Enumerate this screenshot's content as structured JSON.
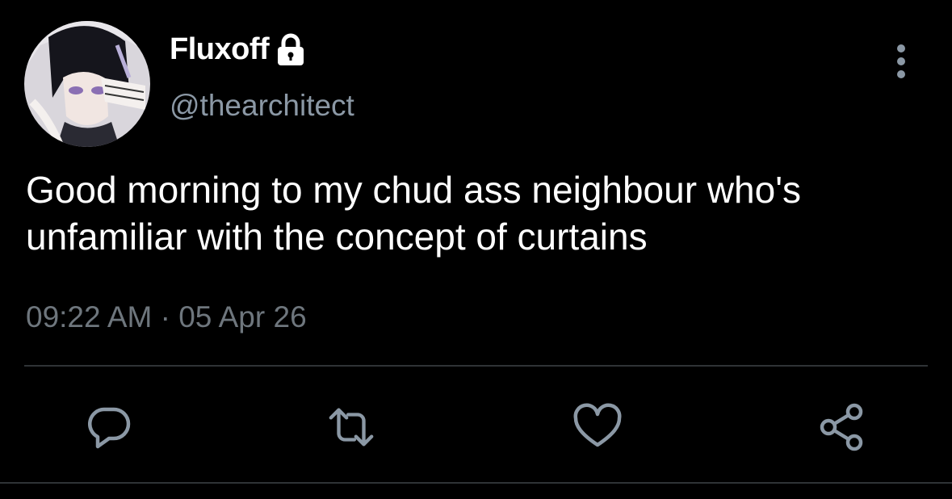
{
  "author": {
    "display_name": "Fluxoff",
    "handle": "@thearchitect",
    "protected": true
  },
  "tweet": {
    "text": "Good morning to my chud ass neighbour who's unfamiliar with the concept of curtains",
    "time": "09:22 AM",
    "separator": "·",
    "date": "05 Apr 26"
  },
  "icons": {
    "avatar": "avatar-image",
    "lock": "lock-icon",
    "more": "more-vertical-icon",
    "reply": "reply-icon",
    "retweet": "retweet-icon",
    "like": "heart-icon",
    "share": "share-icon"
  },
  "colors": {
    "background": "#000000",
    "primary_text": "#ffffff",
    "secondary_text": "#8b98a5",
    "icon": "#8b98a5",
    "divider": "#2f3336"
  }
}
